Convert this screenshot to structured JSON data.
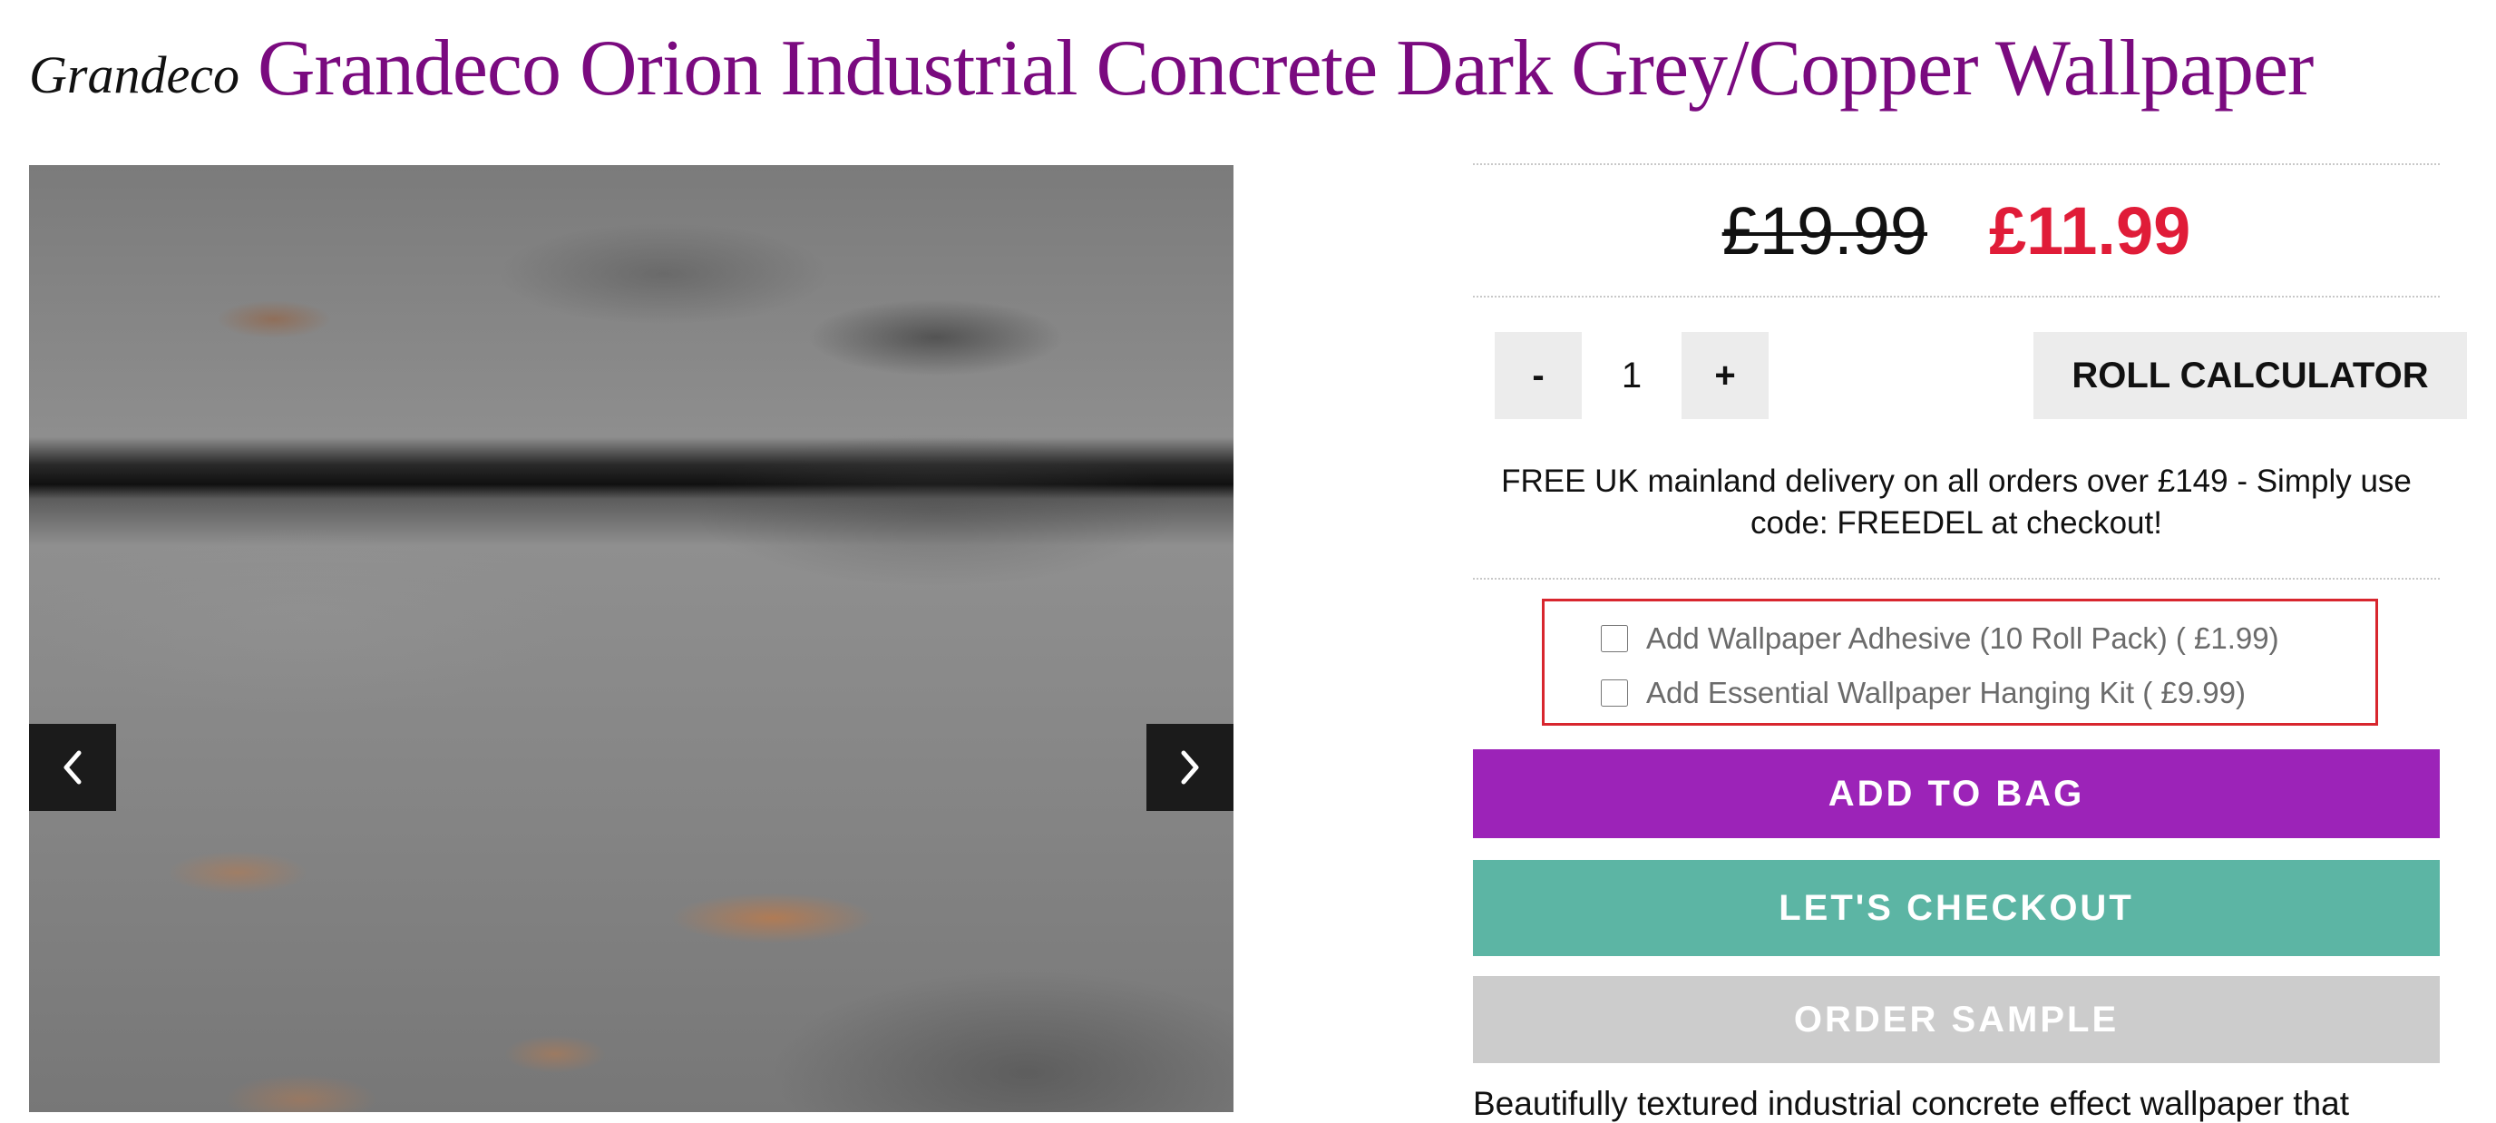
{
  "product": {
    "brand": "Grandeco",
    "title": "Grandeco Orion Industrial Concrete Dark Grey/Copper Wallpaper"
  },
  "gallery": {
    "image_alt": "Textured industrial concrete wallpaper roll in dark grey with copper flecks",
    "prev_icon": "chevron-left-icon",
    "next_icon": "chevron-right-icon"
  },
  "pricing": {
    "old_price": "£19.99",
    "new_price": "£11.99",
    "sale_color": "#e01c38"
  },
  "quantity": {
    "minus_label": "-",
    "value": "1",
    "plus_label": "+"
  },
  "roll_calculator_label": "ROLL CALCULATOR",
  "delivery": {
    "line1": "FREE UK mainland delivery on all orders over £149 - Simply use",
    "line2": "code: FREEDEL at checkout!"
  },
  "addons": [
    {
      "label": "Add Wallpaper Adhesive (10 Roll Pack) ( £1.99)",
      "checked": false
    },
    {
      "label": "Add Essential Wallpaper Hanging Kit ( £9.99)",
      "checked": false
    }
  ],
  "actions": {
    "add_to_bag": "ADD TO BAG",
    "checkout": "LET'S CHECKOUT",
    "order_sample": "ORDER SAMPLE"
  },
  "colors": {
    "title": "#7a0a7f",
    "add_to_bag": "#9c23b8",
    "checkout": "#5cb5a4",
    "sample": "#cccccc",
    "addon_border": "#d8262e"
  },
  "description_start": "Beautifully textured industrial concrete effect wallpaper that"
}
